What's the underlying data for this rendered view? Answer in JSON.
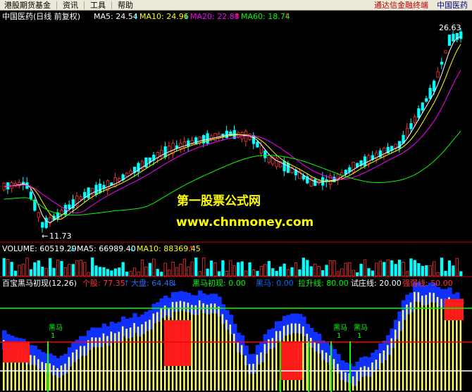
{
  "menubar": {
    "items": [
      "港股期货基金",
      "资讯",
      "工具",
      "帮助"
    ],
    "right_items": [
      "通达信金融终端",
      "中国医药"
    ]
  },
  "main_panel": {
    "title": "中国医药(日线 前复权)",
    "ma5": "MA5: 24.54",
    "ma10": "MA10: 24.96",
    "ma20": "MA20: 22.88",
    "ma60": "MA60: 18.74",
    "high_label": "26.63",
    "low_label": "11.73",
    "watermark_cn": "第一股票公式网",
    "watermark_url": "www.chnmoney.com"
  },
  "volume_panel": {
    "volume": "VOLUME: 60519.29",
    "ma5": "MA5: 66989.40",
    "ma10": "MA10: 88369.45"
  },
  "indicator_panel": {
    "name": "百宝黑马初现(12,26)",
    "stock": "个股: 77.35",
    "market": "大盘: 64.48",
    "heima": "黑马初现: 0.00",
    "heima2": "黑马: 0.00",
    "lasheng": "拉升线: 80.00",
    "shizhuang": "试庄线: 20.00",
    "qiangruo": "强弱线: 50.00",
    "marker_label": "黑马",
    "marker_sub": "1"
  },
  "colors": {
    "up": "#ff3232",
    "down": "#00ffff",
    "ma5": "#ffffff",
    "ma10": "#ffff00",
    "ma20": "#ff00ff",
    "ma60": "#00ff00",
    "panel_line": "#c00000"
  }
}
